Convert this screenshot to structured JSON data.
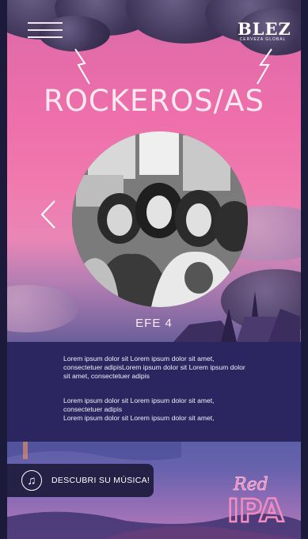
{
  "header": {
    "menu_icon": "hamburger-icon",
    "brand_logo": "BLEZ",
    "brand_tagline": "CERVEZA GLOBAL"
  },
  "hero": {
    "title": "ROCKEROS/AS",
    "photo_alt": "Black and white photo of a band",
    "prev_icon": "chevron-left-icon",
    "caption": "EFE 4"
  },
  "content": {
    "paragraph_1": "Lorem ipsum dolor sit Lorem ipsum dolor sit amet, consectetuer adipisLorem ipsum dolor sit Lorem ipsum dolor sit amet, consectetuer adipis",
    "paragraph_2_line1": "Lorem ipsum dolor sit Lorem ipsum dolor sit amet,",
    "paragraph_2_line2": "consectetuer adipis",
    "paragraph_2_line3": "Lorem ipsum dolor sit Lorem ipsum dolor sit amet,"
  },
  "cta": {
    "icon": "music-note-icon",
    "label": "DESCUBRI SU MÚSICA!"
  },
  "footer_badge": {
    "line1": "Red",
    "line2": "IPA"
  },
  "colors": {
    "sky_pink": "#ee6fab",
    "panel_navy": "#2b2560",
    "cta_bg": "#242046",
    "text_light": "#fde9ef"
  }
}
